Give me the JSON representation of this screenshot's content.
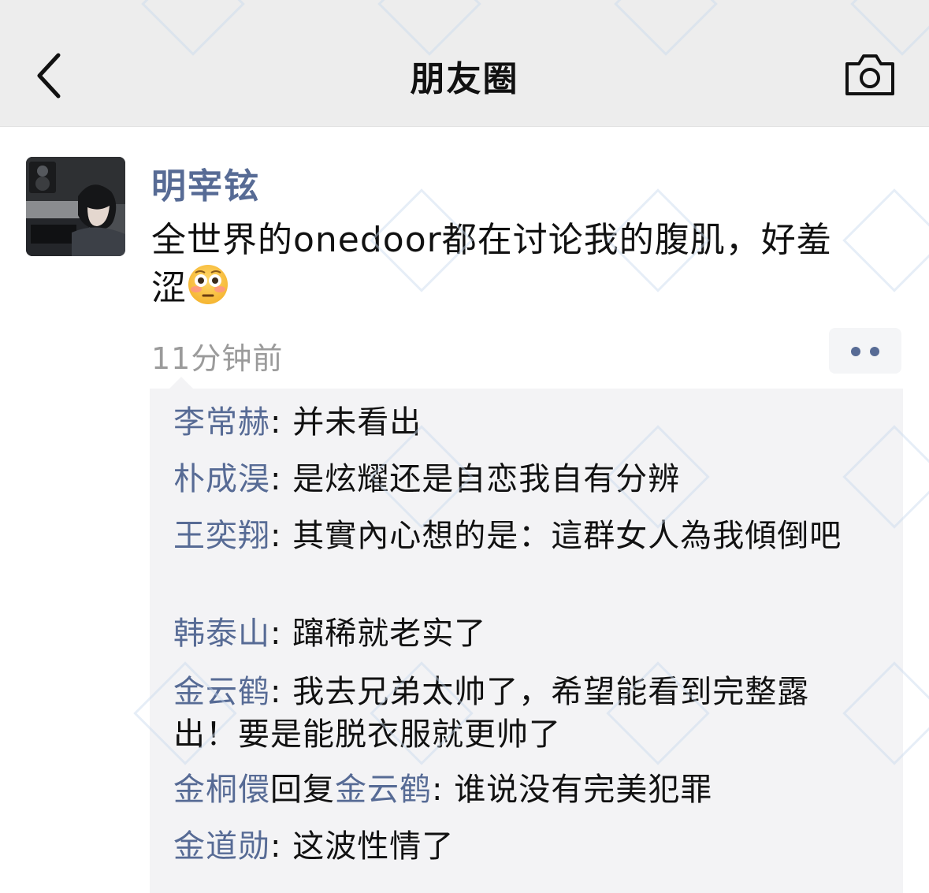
{
  "header": {
    "title": "朋友圈",
    "back_icon": "chevron-left-icon",
    "camera_icon": "camera-icon"
  },
  "post": {
    "author": "明宰铉",
    "text": "全世界的onedoor都在讨论我的腹肌，好羞涩",
    "emoji": "flushed-face-emoji",
    "time": "11分钟前",
    "more_icon": "two-dots-icon"
  },
  "comments": [
    {
      "name": "李常赫",
      "sep": ": ",
      "text": "并未看出"
    },
    {
      "name": "朴成淏",
      "sep": ": ",
      "text": "是炫耀还是自恋我自有分辨"
    },
    {
      "name": "王奕翔",
      "sep": ": ",
      "text": "其實內心想的是：這群女人為我傾倒吧"
    },
    {
      "name": "韩泰山",
      "sep": ": ",
      "text": "蹿稀就老实了"
    },
    {
      "name": "金云鹤",
      "sep": ": ",
      "text": "我去兄弟太帅了，希望能看到完整露出！要是能脱衣服就更帅了"
    },
    {
      "name": "金桐儇",
      "reply_word": "回复",
      "reply_to": "金云鹤",
      "sep": ": ",
      "text": "谁说没有完美犯罪"
    },
    {
      "name": "金道勋",
      "sep": ": ",
      "text": "这波性情了"
    }
  ],
  "colors": {
    "link": "#576b95",
    "navbar_bg": "#ededed",
    "comment_bg": "#f3f3f5",
    "time_gray": "#9b9b9b"
  }
}
